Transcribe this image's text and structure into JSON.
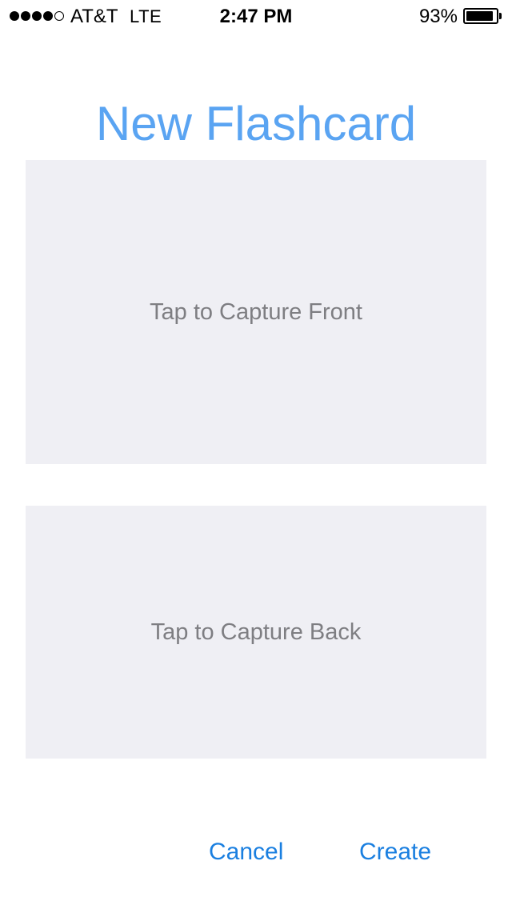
{
  "status_bar": {
    "signal_bars_filled": 4,
    "signal_bars_total": 5,
    "carrier": "AT&T",
    "network": "LTE",
    "time": "2:47 PM",
    "battery_percent_text": "93%",
    "battery_level": 0.93
  },
  "header": {
    "title": "New Flashcard"
  },
  "capture_front": {
    "label": "Tap to Capture Front"
  },
  "capture_back": {
    "label": "Tap to Capture Back"
  },
  "actions": {
    "cancel_label": "Cancel",
    "create_label": "Create"
  },
  "colors": {
    "title": "#5aa4f2",
    "action": "#1a7fe0",
    "capture_background": "#efeff4",
    "capture_text": "#7e7e82"
  }
}
